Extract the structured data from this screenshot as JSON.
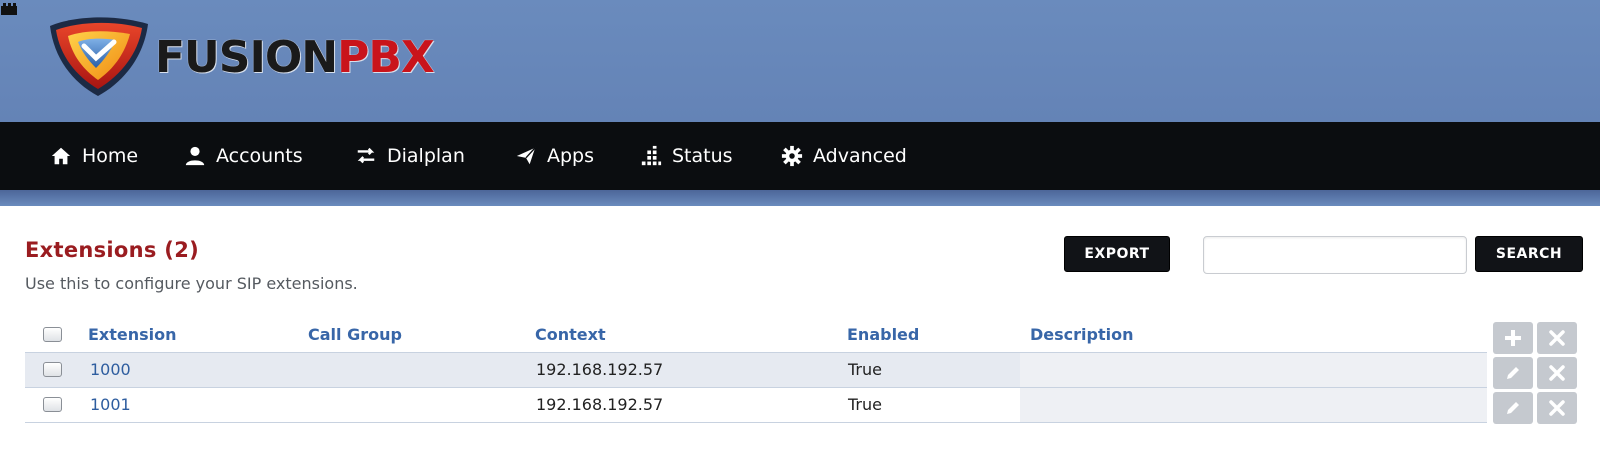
{
  "header": {
    "logo_text_1": "FUSION",
    "logo_text_2": "PBX"
  },
  "nav": {
    "items": [
      {
        "label": "Home",
        "icon": "home-icon"
      },
      {
        "label": "Accounts",
        "icon": "user-icon"
      },
      {
        "label": "Dialplan",
        "icon": "transfer-icon"
      },
      {
        "label": "Apps",
        "icon": "paper-plane-icon"
      },
      {
        "label": "Status",
        "icon": "tasks-icon"
      },
      {
        "label": "Advanced",
        "icon": "gear-icon"
      }
    ]
  },
  "page": {
    "title": "Extensions (2)",
    "description": "Use this to configure your SIP extensions."
  },
  "toolbar": {
    "export_label": "EXPORT",
    "search_label": "SEARCH",
    "search_value": ""
  },
  "table": {
    "columns": [
      "Extension",
      "Call Group",
      "Context",
      "Enabled",
      "Description"
    ],
    "rows": [
      {
        "extension": "1000",
        "call_group": "",
        "context": "192.168.192.57",
        "enabled": "True",
        "description": ""
      },
      {
        "extension": "1001",
        "call_group": "",
        "context": "192.168.192.57",
        "enabled": "True",
        "description": ""
      }
    ]
  },
  "colors": {
    "header_bg": "#6a8bbd",
    "nav_bg": "#0b0d10",
    "title": "#9a1c20",
    "link": "#2e5d9f"
  }
}
